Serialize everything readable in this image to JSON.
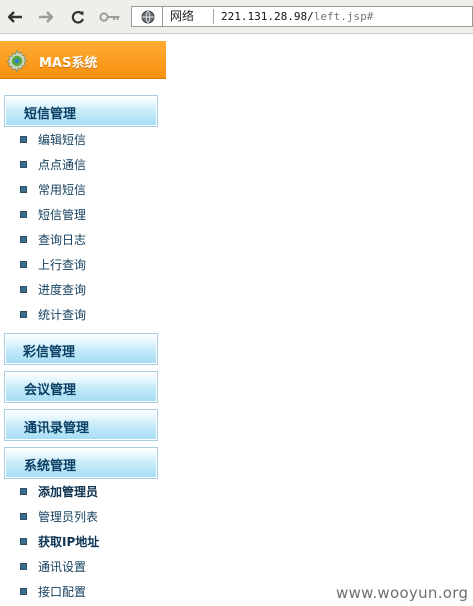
{
  "browser": {
    "address": {
      "zone_label": "网络",
      "url_host": "221.131.28.98/",
      "url_path": "left.jsp#"
    }
  },
  "brand": {
    "title": "MAS系统"
  },
  "sections": [
    {
      "label": "短信管理",
      "items": [
        {
          "label": "编辑短信",
          "bold": false
        },
        {
          "label": "点点通信",
          "bold": false
        },
        {
          "label": "常用短信",
          "bold": false
        },
        {
          "label": "短信管理",
          "bold": false
        },
        {
          "label": "查询日志",
          "bold": false
        },
        {
          "label": "上行查询",
          "bold": false
        },
        {
          "label": "进度查询",
          "bold": false
        },
        {
          "label": "统计查询",
          "bold": false
        }
      ]
    },
    {
      "label": "彩信管理",
      "items": []
    },
    {
      "label": "会议管理",
      "items": []
    },
    {
      "label": "通讯录管理",
      "items": []
    },
    {
      "label": "系统管理",
      "items": [
        {
          "label": "添加管理员",
          "bold": true
        },
        {
          "label": "管理员列表",
          "bold": false
        },
        {
          "label": "获取IP地址",
          "bold": true
        },
        {
          "label": "通讯设置",
          "bold": false
        },
        {
          "label": "接口配置",
          "bold": false
        }
      ]
    }
  ],
  "watermark": "www.wooyun.org"
}
